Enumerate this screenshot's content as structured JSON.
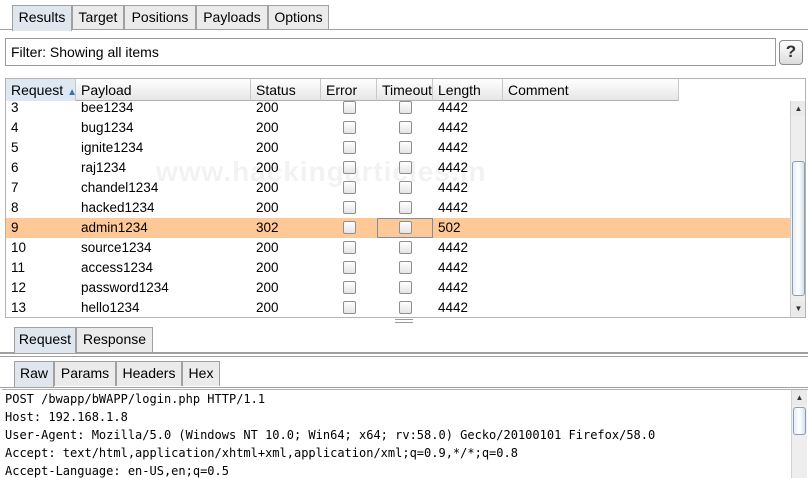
{
  "top_tabs": [
    "Results",
    "Target",
    "Positions",
    "Payloads",
    "Options"
  ],
  "filter": {
    "text": "Filter: Showing all items",
    "help_label": "?"
  },
  "columns": [
    "Request",
    "Payload",
    "Status",
    "Error",
    "Timeout",
    "Length",
    "Comment"
  ],
  "sort_indicator": "▲",
  "rows": [
    {
      "request": "3",
      "payload": "bee1234",
      "status": "200",
      "length": "4442"
    },
    {
      "request": "4",
      "payload": "bug1234",
      "status": "200",
      "length": "4442"
    },
    {
      "request": "5",
      "payload": "ignite1234",
      "status": "200",
      "length": "4442"
    },
    {
      "request": "6",
      "payload": "raj1234",
      "status": "200",
      "length": "4442"
    },
    {
      "request": "7",
      "payload": "chandel1234",
      "status": "200",
      "length": "4442"
    },
    {
      "request": "8",
      "payload": "hacked1234",
      "status": "200",
      "length": "4442"
    },
    {
      "request": "9",
      "payload": "admin1234",
      "status": "302",
      "length": "502",
      "selected": true
    },
    {
      "request": "10",
      "payload": "source1234",
      "status": "200",
      "length": "4442"
    },
    {
      "request": "11",
      "payload": "access1234",
      "status": "200",
      "length": "4442"
    },
    {
      "request": "12",
      "payload": "password1234",
      "status": "200",
      "length": "4442"
    },
    {
      "request": "13",
      "payload": "hello1234",
      "status": "200",
      "length": "4442"
    }
  ],
  "watermark": "www.hackingarticles.in",
  "rr_tabs": [
    "Request",
    "Response"
  ],
  "inner_tabs": [
    "Raw",
    "Params",
    "Headers",
    "Hex"
  ],
  "raw_lines": [
    "POST /bwapp/bWAPP/login.php HTTP/1.1",
    "Host: 192.168.1.8",
    "User-Agent: Mozilla/5.0 (Windows NT 10.0; Win64; x64; rv:58.0) Gecko/20100101 Firefox/58.0",
    "Accept: text/html,application/xhtml+xml,application/xml;q=0.9,*/*;q=0.8",
    "Accept-Language: en-US,en;q=0.5"
  ],
  "colors": {
    "selected_row": "#ffc897",
    "active_tab": "#dfe6ee",
    "sort_arrow": "#3a6fb0"
  }
}
